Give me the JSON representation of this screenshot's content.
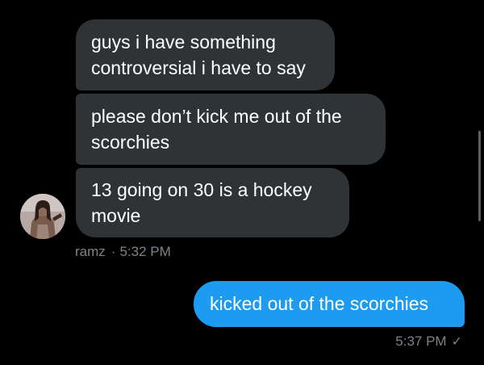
{
  "conversation": {
    "incoming": {
      "messages": [
        "guys i have something controversial i have to say",
        "please don’t kick me out of the scorchies",
        "13 going on 30 is a hockey movie"
      ],
      "sender_name": "ramz",
      "separator": "·",
      "time": "5:32 PM",
      "avatar_icon": "user-photo-avatar"
    },
    "outgoing": {
      "message": "kicked out of the scorchies",
      "time": "5:37 PM",
      "status_icon": "checkmark-icon",
      "status_glyph": "✓"
    }
  },
  "colors": {
    "background": "#000000",
    "incoming_bubble": "#2f3336",
    "outgoing_bubble": "#1d9bf0",
    "meta_text": "#7c8388"
  }
}
